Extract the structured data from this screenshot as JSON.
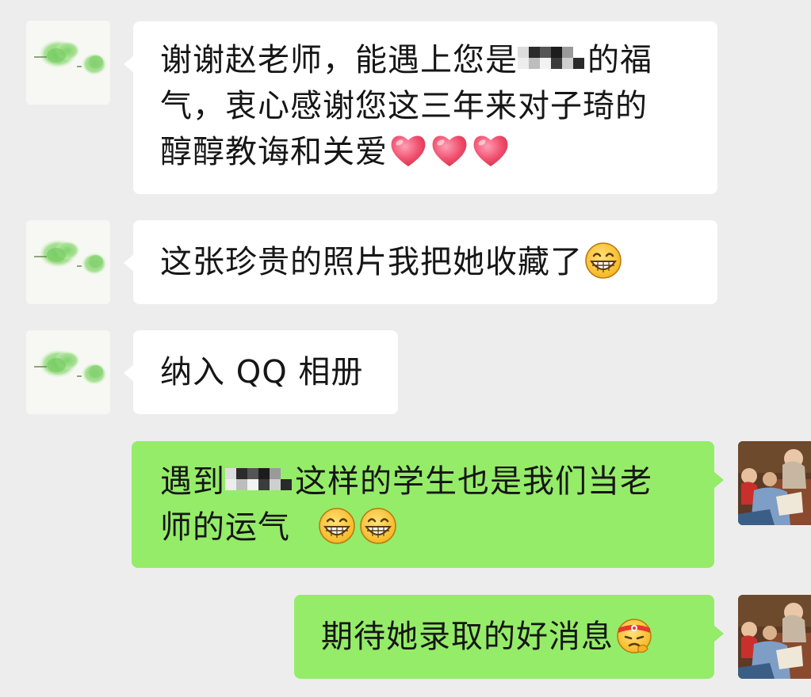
{
  "messages": [
    {
      "side": "in",
      "lines": [
        "谢谢赵老师，能遇上您是",
        "的福",
        "气，衷心感谢您这三年来对子琦的",
        "醇醇教诲和关爱"
      ]
    },
    {
      "side": "in",
      "text": "这张珍贵的照片我把她收藏了"
    },
    {
      "side": "in",
      "text": "纳入 QQ 相册"
    },
    {
      "side": "out",
      "lines": [
        "遇到",
        "这样的学生也是我们当老",
        "师的运气"
      ]
    },
    {
      "side": "out",
      "text": "期待她录取的好消息"
    }
  ],
  "icons": {
    "contact_avatar": "green-watercolor-avatar",
    "self_avatar": "painting-avatar",
    "heart": "red-heart-emoji",
    "grin": "grinning-emoji",
    "determined": "determined-headband-emoji",
    "censor": "pixel-mosaic"
  },
  "colors": {
    "background": "#ededed",
    "incoming_bubble": "#ffffff",
    "outgoing_bubble": "#95ec69",
    "text": "#161616"
  }
}
